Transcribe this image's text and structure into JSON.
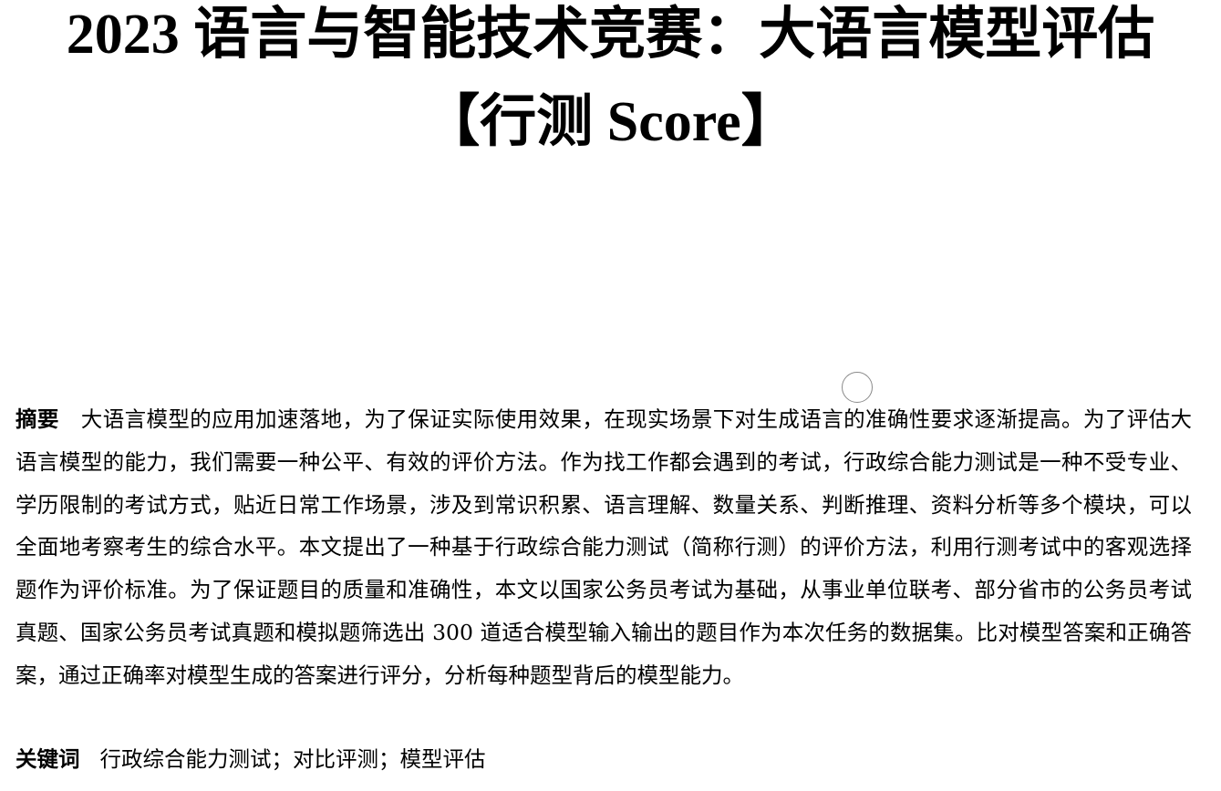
{
  "document": {
    "title_line1": "2023 语言与智能技术竞赛：大语言模型评估",
    "title_line2": "【行测 Score】",
    "abstract_label": "摘要",
    "abstract_text": "大语言模型的应用加速落地，为了保证实际使用效果，在现实场景下对生成语言的准确性要求逐渐提高。为了评估大语言模型的能力，我们需要一种公平、有效的评价方法。作为找工作都会遇到的考试，行政综合能力测试是一种不受专业、学历限制的考试方式，贴近日常工作场景，涉及到常识积累、语言理解、数量关系、判断推理、资料分析等多个模块，可以全面地考察考生的综合水平。本文提出了一种基于行政综合能力测试（简称行测）的评价方法，利用行测考试中的客观选择题作为评价标准。为了保证题目的质量和准确性，本文以国家公务员考试为基础，从事业单位联考、部分省市的公务员考试真题、国家公务员考试真题和模拟题筛选出 300 道适合模型输入输出的题目作为本次任务的数据集。比对模型答案和正确答案，通过正确率对模型生成的答案进行评分，分析每种题型背后的模型能力。",
    "keywords_label": "关键词",
    "keywords_text": "行政综合能力测试；对比评测；模型评估"
  }
}
